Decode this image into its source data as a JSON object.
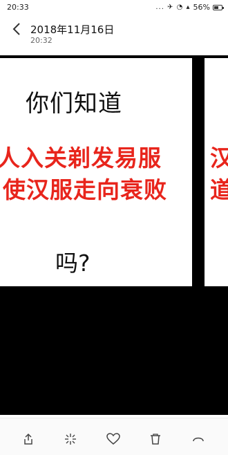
{
  "status_bar": {
    "time": "20:33",
    "icons": "... ✈ ◔ ▴",
    "battery": "56%",
    "battery_level": 0.56
  },
  "header": {
    "title": "2018年11月16日",
    "subtitle": "20:32"
  },
  "slide": {
    "line1": "你们知道",
    "line2": "人入关剃发易服",
    "line3": "使汉服走向衰败",
    "line4": "吗?"
  },
  "slide_next": {
    "line2": "汉",
    "line3": "道"
  },
  "toolbar": {
    "items": [
      "share-icon",
      "sparkle-icon",
      "heart-icon",
      "trash-icon",
      "more-icon"
    ]
  },
  "colors": {
    "accent_red": "#e8251c",
    "viewer_bg": "#000000"
  }
}
